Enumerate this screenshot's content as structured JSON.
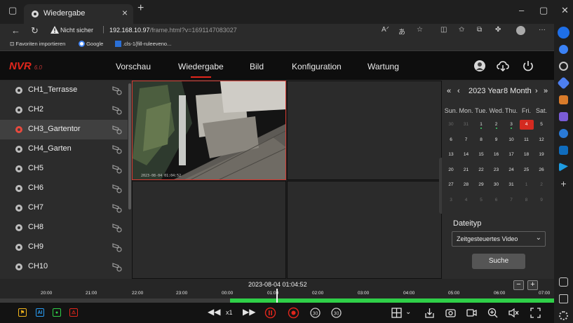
{
  "browser": {
    "tab_title": "Wiedergabe",
    "security_label": "Nicht sicher",
    "url_host": "192.168.10.97",
    "url_path": "/frame.html?v=1691147083027",
    "favorites": [
      "Favoriten importieren",
      "Google",
      ".cls-1{fill-ruleevenо..."
    ]
  },
  "nvr": {
    "logo": "NVR",
    "logo_version": "6.0",
    "nav": [
      {
        "label": "Vorschau",
        "active": false
      },
      {
        "label": "Wiedergabe",
        "active": true
      },
      {
        "label": "Bild",
        "active": false
      },
      {
        "label": "Konfiguration",
        "active": false
      },
      {
        "label": "Wartung",
        "active": false
      }
    ]
  },
  "channels": [
    {
      "name": "CH1_Terrasse",
      "recording": false,
      "selected": false
    },
    {
      "name": "CH2",
      "recording": false,
      "selected": false
    },
    {
      "name": "CH3_Gartentor",
      "recording": true,
      "selected": true
    },
    {
      "name": "CH4_Garten",
      "recording": false,
      "selected": false
    },
    {
      "name": "CH5",
      "recording": false,
      "selected": false
    },
    {
      "name": "CH6",
      "recording": false,
      "selected": false
    },
    {
      "name": "CH7",
      "recording": false,
      "selected": false
    },
    {
      "name": "CH8",
      "recording": false,
      "selected": false
    },
    {
      "name": "CH9",
      "recording": false,
      "selected": false
    },
    {
      "name": "CH10",
      "recording": false,
      "selected": false
    }
  ],
  "video": {
    "osd_text": "2023-08-04 01:04:52"
  },
  "calendar": {
    "year_label": "2023 Year",
    "month_label": "8 Month",
    "weekdays": [
      "Sun.",
      "Mon.",
      "Tue.",
      "Wed.",
      "Thu.",
      "Fri.",
      "Sat."
    ],
    "weeks": [
      [
        "30",
        "31",
        "1",
        "2",
        "3",
        "4",
        "5"
      ],
      [
        "6",
        "7",
        "8",
        "9",
        "10",
        "11",
        "12"
      ],
      [
        "13",
        "14",
        "15",
        "16",
        "17",
        "18",
        "19"
      ],
      [
        "20",
        "21",
        "22",
        "23",
        "24",
        "25",
        "26"
      ],
      [
        "27",
        "28",
        "29",
        "30",
        "31",
        "1",
        "2"
      ],
      [
        "3",
        "4",
        "5",
        "6",
        "7",
        "8",
        "9"
      ]
    ],
    "recorded_days": [
      "1",
      "2",
      "3"
    ],
    "selected_day": "4",
    "file_type_label": "Dateityp",
    "file_type_value": "Zeitgesteuertes Video",
    "search_label": "Suche"
  },
  "timeline": {
    "current_time": "2023-08-04 01:04:52",
    "ticks": [
      "20:00",
      "21:00",
      "22:00",
      "23:00",
      "00:00",
      "01:00",
      "02:00",
      "03:00",
      "04:00",
      "05:00",
      "06:00",
      "07:00"
    ],
    "zoom_out": "−",
    "zoom_in": "+"
  },
  "controls": {
    "speed_label": "x1",
    "legend": [
      "#f1b41c",
      "#2a9df4",
      "#2fcf48",
      "#e1261c"
    ]
  },
  "colors": {
    "accent": "#e1261c",
    "record_bar": "#2fcf48"
  }
}
